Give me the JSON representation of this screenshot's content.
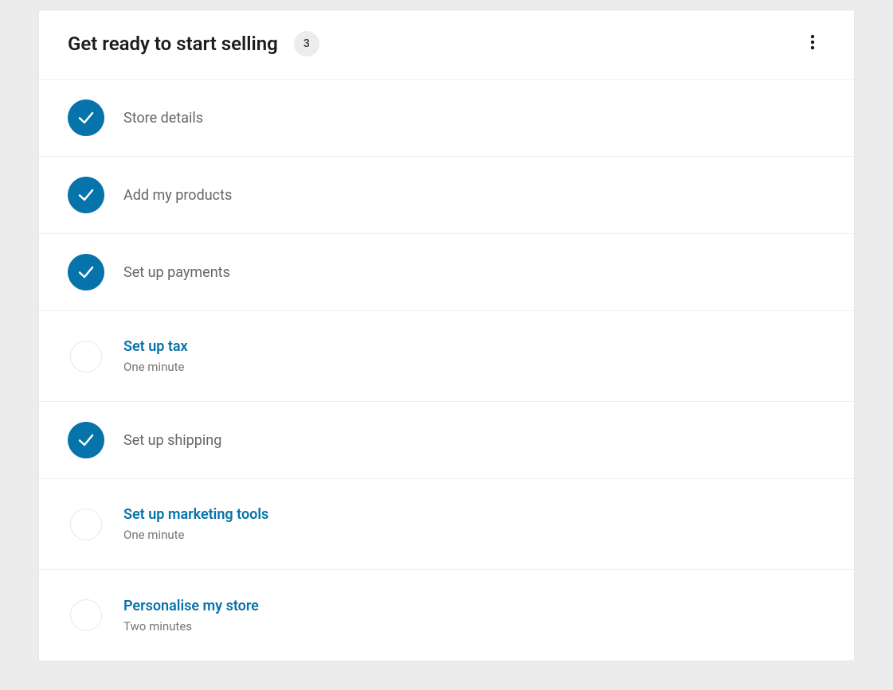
{
  "header": {
    "title": "Get ready to start selling",
    "remaining_count": "3"
  },
  "tasks": [
    {
      "title": "Store details",
      "completed": true,
      "subtitle": ""
    },
    {
      "title": "Add my products",
      "completed": true,
      "subtitle": ""
    },
    {
      "title": "Set up payments",
      "completed": true,
      "subtitle": ""
    },
    {
      "title": "Set up tax",
      "completed": false,
      "subtitle": "One minute"
    },
    {
      "title": "Set up shipping",
      "completed": true,
      "subtitle": ""
    },
    {
      "title": "Set up marketing tools",
      "completed": false,
      "subtitle": "One minute"
    },
    {
      "title": "Personalise my store",
      "completed": false,
      "subtitle": "Two minutes"
    }
  ]
}
